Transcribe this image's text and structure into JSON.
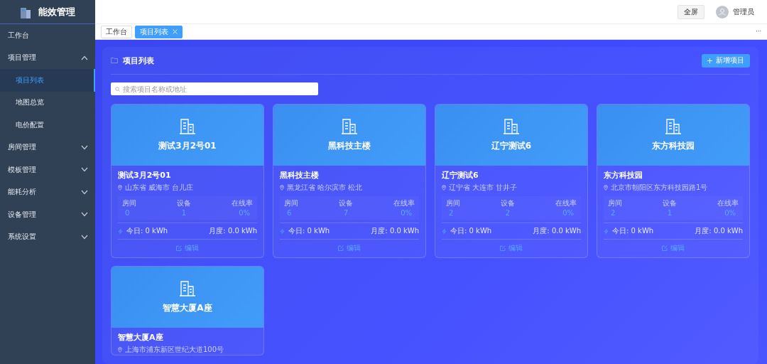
{
  "brand": {
    "title": "能效管理"
  },
  "sidebar": {
    "items": [
      {
        "label": "工作台",
        "selected": false
      },
      {
        "label": "项目管理",
        "expanded": true,
        "selected": false,
        "children": [
          {
            "label": "项目列表",
            "selected": true
          },
          {
            "label": "地图总览",
            "selected": false
          },
          {
            "label": "电价配置",
            "selected": false
          }
        ]
      },
      {
        "label": "房间管理",
        "expanded": false,
        "selected": false
      },
      {
        "label": "模板管理",
        "expanded": false,
        "selected": false
      },
      {
        "label": "能耗分析",
        "expanded": false,
        "selected": false
      },
      {
        "label": "设备管理",
        "expanded": false,
        "selected": false
      },
      {
        "label": "系统设置",
        "expanded": false,
        "selected": false
      }
    ]
  },
  "header": {
    "fullscreen": "全屏",
    "user": "管理员"
  },
  "tabs": [
    {
      "label": "工作台",
      "selected": false,
      "closable": false
    },
    {
      "label": "项目列表",
      "selected": true,
      "closable": true
    }
  ],
  "tabs_more": "···",
  "panel": {
    "title": "项目列表",
    "add_button": "新增项目",
    "search": {
      "placeholder": "搜索项目名称或地址"
    }
  },
  "projects": [
    {
      "banner": "测试3月2号01",
      "name": "测试3月2号01",
      "address": "山东省 威海市 台儿庄",
      "stats": [
        {
          "label": "房间",
          "value": "0"
        },
        {
          "label": "设备",
          "value": "1"
        },
        {
          "label": "在线率",
          "value": "0%"
        }
      ],
      "today": "今日: 0 kWh",
      "month": "月度: 0.0 kWh",
      "edit": "编辑"
    },
    {
      "banner": "黑科技主楼",
      "name": "黑科技主楼",
      "address": "黑龙江省 哈尔滨市 松北",
      "stats": [
        {
          "label": "房间",
          "value": "6"
        },
        {
          "label": "设备",
          "value": "7"
        },
        {
          "label": "在线率",
          "value": "0%"
        }
      ],
      "today": "今日: 0 kWh",
      "month": "月度: 0.0 kWh",
      "edit": "编辑"
    },
    {
      "banner": "辽宁测试6",
      "name": "辽宁测试6",
      "address": "辽宁省 大连市 甘井子",
      "stats": [
        {
          "label": "房间",
          "value": "2"
        },
        {
          "label": "设备",
          "value": "2"
        },
        {
          "label": "在线率",
          "value": "0%"
        }
      ],
      "today": "今日: 0 kWh",
      "month": "月度: 0.0 kWh",
      "edit": "编辑"
    },
    {
      "banner": "东方科技园",
      "name": "东方科技园",
      "address": "北京市朝阳区东方科技园路1号",
      "stats": [
        {
          "label": "房间",
          "value": "2"
        },
        {
          "label": "设备",
          "value": "1"
        },
        {
          "label": "在线率",
          "value": "0%"
        }
      ],
      "today": "今日: 0 kWh",
      "month": "月度: 0.0 kWh",
      "edit": "编辑"
    },
    {
      "banner": "智慧大厦A座",
      "name": "智慧大厦A座",
      "address": "上海市浦东新区世纪大道100号"
    }
  ]
}
